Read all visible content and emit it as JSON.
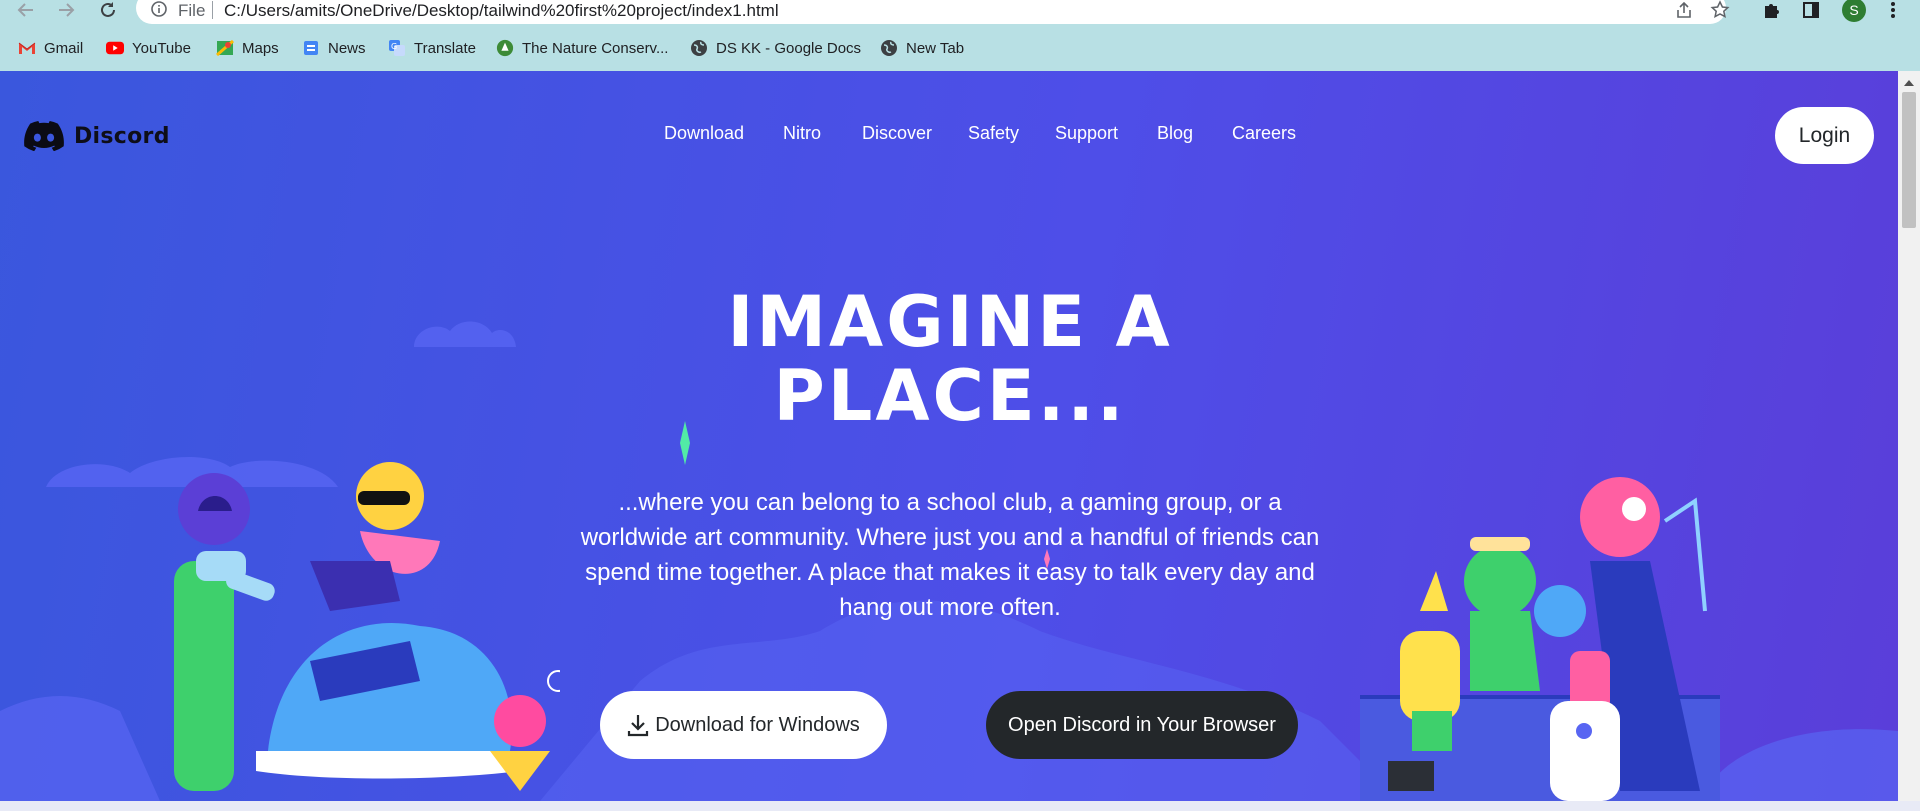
{
  "browser": {
    "omnibox_scheme": "File",
    "url": "C:/Users/amits/OneDrive/Desktop/tailwind%20first%20project/index1.html",
    "profile_initial": "S",
    "bookmarks": [
      {
        "label": "Gmail",
        "icon": "gmail-icon"
      },
      {
        "label": "YouTube",
        "icon": "youtube-icon"
      },
      {
        "label": "Maps",
        "icon": "maps-icon"
      },
      {
        "label": "News",
        "icon": "news-icon"
      },
      {
        "label": "Translate",
        "icon": "translate-icon"
      },
      {
        "label": "The Nature Conserv...",
        "icon": "nature-conservancy-icon"
      },
      {
        "label": "DS KK - Google Docs",
        "icon": "globe-icon"
      },
      {
        "label": "New Tab",
        "icon": "globe-icon"
      }
    ]
  },
  "site": {
    "brand": "Discord",
    "nav": [
      "Download",
      "Nitro",
      "Discover",
      "Safety",
      "Support",
      "Blog",
      "Careers"
    ],
    "login_label": "Login",
    "hero": {
      "title_line1": "IMAGINE A",
      "title_line2": "PLACE...",
      "text": "...where you can belong to a school club, a gaming group, or a worldwide art community. Where just you and a handful of friends can spend time together. A place that makes it easy to talk every day and hang out more often."
    },
    "download_button": "Download for Windows",
    "browser_button": "Open Discord in Your Browser"
  },
  "colors": {
    "page_bg_start": "#3a57dd",
    "page_bg_end": "#5a3ed9",
    "dark_button": "#23272a",
    "chrome_bg": "#b8e0e4"
  }
}
